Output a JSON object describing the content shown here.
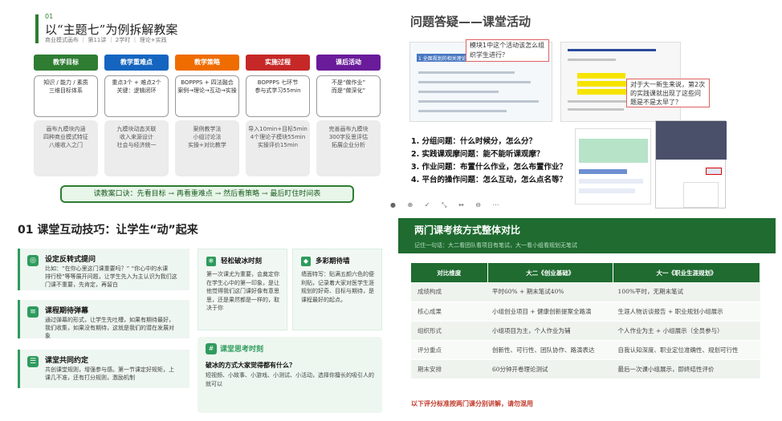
{
  "panel1": {
    "num": "01",
    "title": "以“主题七”为例拆解教案",
    "meta": "商业模式画布 ｜ 第11讲 ｜ 2学时 ｜ 理论+实践",
    "cols": [
      {
        "head": "教学目标",
        "color": "#2e7d32",
        "box1": "知识 / 能力 / 素质\n三维目标体系",
        "box2": "画布九模块内涵\n四种商业模式特征\n八维收入之门"
      },
      {
        "head": "教学重难点",
        "color": "#1565c0",
        "box1": "重点3个 + 难点2个\n关键：逻辑闭环",
        "box2": "九模块动态关联\n收入来源设计\n社会与经济统一"
      },
      {
        "head": "教学策略",
        "color": "#ef6c00",
        "box1": "BOPPPS + 四法融合\n案例→理论→互动→实操",
        "box2": "案例教学法\n小组讨论法\n实操+对比教学"
      },
      {
        "head": "实施过程",
        "color": "#c62828",
        "box1": "BOPPPS 七环节\n参与式学习55min",
        "box2": "导入10min+目标5min\n4个理论子模块55min\n实操评价15min"
      },
      {
        "head": "课后活动",
        "color": "#6a1b9a",
        "box1": "不是“做作业”\n而是“做深化”",
        "box2": "完善画布九模块\n300字反思评估\n拓展企业分析"
      }
    ],
    "footer": "读教案口诀：先看目标 → 再看重难点 → 然后看策略 → 最后盯住时间表"
  },
  "panel2": {
    "title": "问题答疑——课堂活动",
    "callout1": "模块1中这个活动该怎么组织学生进行？",
    "callout2": "对于大一新生来说，第2次的实践课就出现了这些问题是不是太早了？",
    "slideA_label": "1 全面规划的相关理论",
    "questions": [
      "1. 分组问题：什么时候分，怎么分？",
      "2. 实践课观摩问题：能不能听课观摩？",
      "3. 作业问题：布置什么作业，怎么布置作业？",
      "4. 平台的操作问题：怎么互动，怎么点名等？"
    ],
    "icons": "● ⊕ ✓ ⤡ ↔ ⊖ ⋯"
  },
  "panel3": {
    "title": "01 课堂互动技巧：让学生“动”起来",
    "cards": [
      {
        "title": "设定反转式提问",
        "text": "比如：“在你心里这门课重要吗？” “你心中的水课\n排行榜”等等展开问题，让学生先入为主认识为我们这\n门课不重要，先肯定，再留白"
      },
      {
        "title": "课程期待弹幕",
        "text": "通过弹幕的形式，让学生先吐槽，如果有期待最好，\n我们收集，如果没有期待，这就是我们的潜在发展对\n象"
      },
      {
        "title": "课堂共同约定",
        "text": "共创课堂规则，增强参与感。第一节课定好规矩，上\n课几不准，还有打分规则，激励机制"
      }
    ],
    "mini1": {
      "title": "轻松破冰时刻",
      "text": "第一次课尤为重要，会奠定你\n在学生心中的第一印象，是让\n他觉得我们这门课好像有意思\n思，还是果然都是一样的，取\n决于你"
    },
    "mini2": {
      "title": "多彩期待墙",
      "text": "墙面特写：贴满五颜六色的便\n利贴，记录着大家对医学生涯\n规划的好奇、目标与期待，是\n课程最好的起点。"
    },
    "think": {
      "title": "课堂思考时刻",
      "q": "破冰的方式大家觉得都有什么？",
      "text": "短视频、小故事、小游戏、小测试、小活动，选择你擅长的吸引人的就可以"
    }
  },
  "panel4": {
    "title": "两门课考核方式整体对比",
    "sub": "记住一句话：大二看团队看项目有笔试，大一看小组看规划无笔试",
    "headers": [
      "对比维度",
      "大二《创业基础》",
      "大一《职业生涯规划》"
    ],
    "rows": [
      [
        "成绩构成",
        "平时60% + 期末笔试40%",
        "100%平时，无期末笔试"
      ],
      [
        "核心成果",
        "小组创业项目 + 健康创新提案全路演",
        "生涯人物访谈报告 + 职业规划小组展示"
      ],
      [
        "组织形式",
        "小组项目为主，个人作业为辅",
        "个人作业为主 + 小组展示（全员参与）"
      ],
      [
        "评分重点",
        "创新性、可行性、团队协作、路演表达",
        "自我认知深度、职业定位准确性、规划可行性"
      ],
      [
        "期末安排",
        "60分钟开卷理论测试",
        "最后一次课小组展示，即终结性评价"
      ]
    ],
    "note": "以下评分标准按两门课分别讲解，请勿混用"
  }
}
